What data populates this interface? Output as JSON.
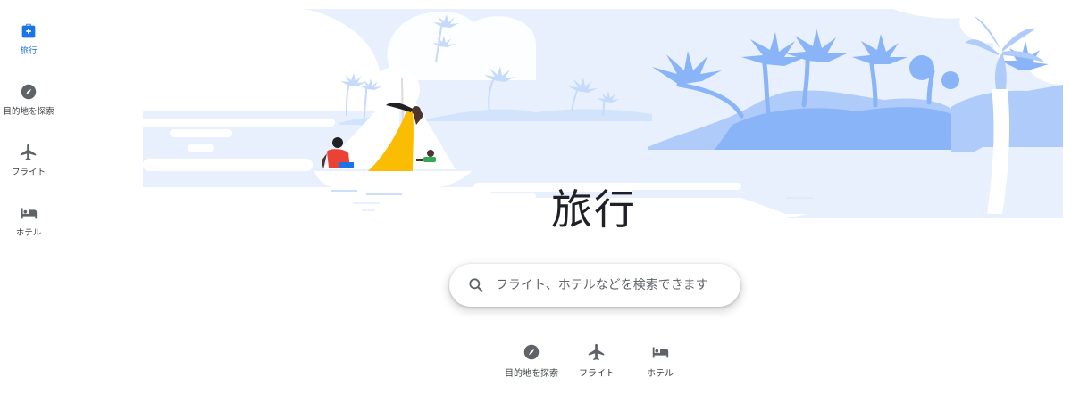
{
  "colors": {
    "accent": "#1a73e8",
    "text": "#3c4043",
    "title": "#202124",
    "hero_light": "#e8f0fe",
    "hero_mid": "#aecbfa",
    "hero_dark": "#8ab4f8"
  },
  "sidebar": {
    "items": [
      {
        "label": "旅行",
        "icon": "travel-bag-icon",
        "active": true
      },
      {
        "label": "目的地を探索",
        "icon": "explore-compass-icon",
        "active": false
      },
      {
        "label": "フライト",
        "icon": "flight-icon",
        "active": false
      },
      {
        "label": "ホテル",
        "icon": "hotel-bed-icon",
        "active": false
      }
    ]
  },
  "main": {
    "title": "旅行",
    "search": {
      "placeholder": "フライト、ホテルなどを検索できます",
      "value": ""
    },
    "chips": [
      {
        "label": "目的地を探索",
        "icon": "explore-compass-icon"
      },
      {
        "label": "フライト",
        "icon": "flight-icon"
      },
      {
        "label": "ホテル",
        "icon": "hotel-bed-icon"
      }
    ]
  }
}
